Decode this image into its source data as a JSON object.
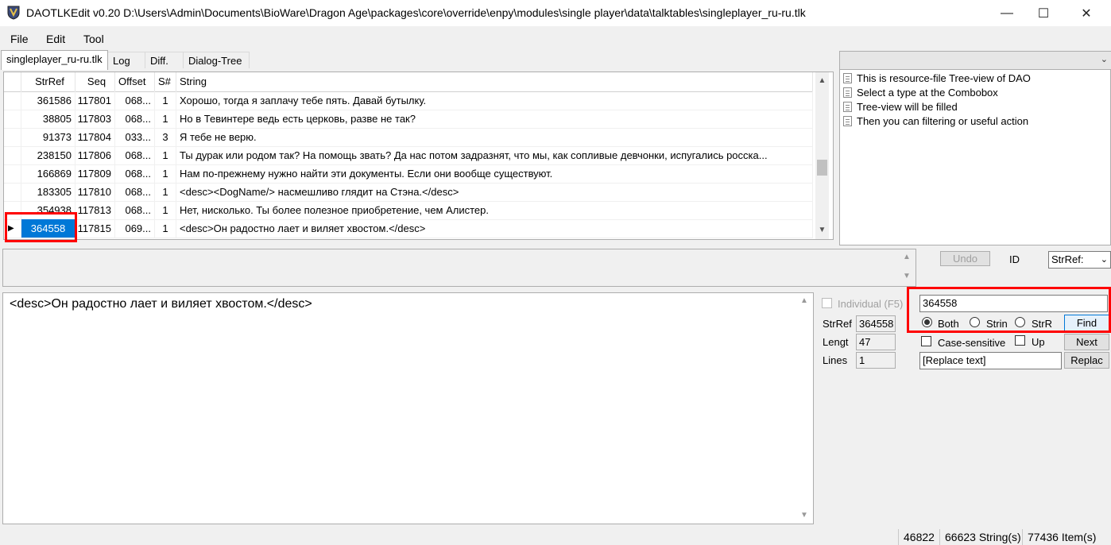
{
  "window": {
    "title": "DAOTLKEdit v0.20 D:\\Users\\Admin\\Documents\\BioWare\\Dragon Age\\packages\\core\\override\\enpy\\modules\\single player\\data\\talktables\\singleplayer_ru-ru.tlk",
    "minimize": "—",
    "maximize": "☐",
    "close": "✕"
  },
  "menu": [
    "File",
    "Edit",
    "Tool"
  ],
  "tabs": [
    "singleplayer_ru-ru.tlk",
    "Log",
    "Diff.",
    "Dialog-Tree"
  ],
  "grid": {
    "columns": [
      "StrRef",
      "Seq",
      "Offset",
      "S#",
      "String"
    ],
    "rows": [
      {
        "strref": "361586",
        "seq": "117801",
        "offset": "068...",
        "s": "1",
        "string": "Хорошо, тогда я заплачу тебе пять. Давай бутылку."
      },
      {
        "strref": "38805",
        "seq": "117803",
        "offset": "068...",
        "s": "1",
        "string": "Но в Тевинтере ведь есть церковь, разве не так?"
      },
      {
        "strref": "91373",
        "seq": "117804",
        "offset": "033...",
        "s": "3",
        "string": "Я тебе не верю."
      },
      {
        "strref": "238150",
        "seq": "117806",
        "offset": "068...",
        "s": "1",
        "string": "Ты дурак или родом так? На помощь звать? Да нас потом задразнят, что мы, как сопливые девчонки, испугались росска..."
      },
      {
        "strref": "166869",
        "seq": "117809",
        "offset": "068...",
        "s": "1",
        "string": "Нам по-прежнему нужно найти эти документы. Если они вообще существуют."
      },
      {
        "strref": "183305",
        "seq": "117810",
        "offset": "068...",
        "s": "1",
        "string": "<desc><DogName/> насмешливо глядит на Стэна.</desc>"
      },
      {
        "strref": "354938",
        "seq": "117813",
        "offset": "068...",
        "s": "1",
        "string": "Нет, нисколько. Ты более полезное приобретение, чем Алистер."
      },
      {
        "strref": "364558",
        "seq": "117815",
        "offset": "069...",
        "s": "1",
        "string": "<desc>Он радостно лает и виляет хвостом.</desc>"
      }
    ],
    "selected_row": 7
  },
  "tree": {
    "items": [
      "This is resource-file Tree-view of DAO",
      "Select a type at the Combobox",
      "Tree-view will be filled",
      "Then you can filtering or useful action"
    ]
  },
  "editor": {
    "text": "<desc>Он радостно лает и виляет хвостом.</desc>"
  },
  "controls": {
    "undo": "Undo",
    "id_label": "ID",
    "id_select": "StrRef:",
    "individual_label": "Individual (F5)",
    "strref_label": "StrRef",
    "strref_value": "364558",
    "length_label": "Lengt",
    "length_value": "47",
    "lines_label": "Lines",
    "lines_value": "1",
    "search_value": "364558",
    "radio_both": "Both",
    "radio_string": "Strin",
    "radio_strref": "StrR",
    "find": "Find",
    "case_sensitive": "Case-sensitive",
    "up": "Up",
    "next": "Next",
    "replace_placeholder": "[Replace text]",
    "replace": "Replac"
  },
  "status": [
    "46822",
    "66623 String(s)",
    "77436 Item(s)"
  ],
  "colors": {
    "selection": "#0078d7",
    "highlight": "#ff0000"
  }
}
